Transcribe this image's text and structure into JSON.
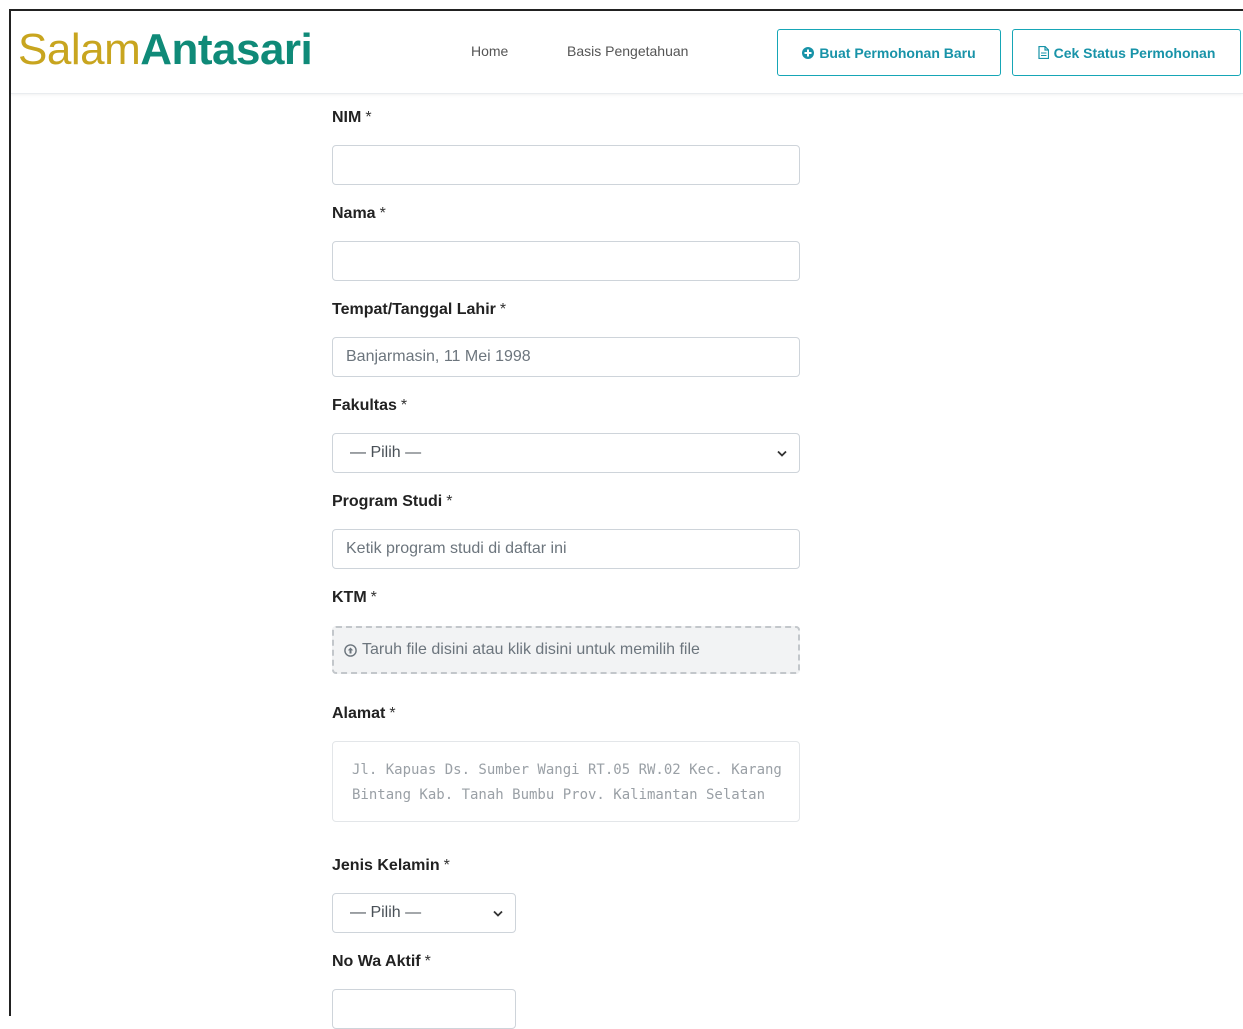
{
  "brand": {
    "part1": "Salam",
    "part2": "Antasari"
  },
  "nav": {
    "home": "Home",
    "knowledge_base": "Basis Pengetahuan",
    "new_request": "Buat Permohonan Baru",
    "check_status": "Cek Status Permohonan"
  },
  "form": {
    "nim": {
      "label": "NIM",
      "required": "*",
      "value": "",
      "placeholder": ""
    },
    "nama": {
      "label": "Nama",
      "required": "*",
      "value": "",
      "placeholder": ""
    },
    "ttl": {
      "label": "Tempat/Tanggal Lahir",
      "required": "*",
      "placeholder": "Banjarmasin, 11 Mei 1998"
    },
    "fakultas": {
      "label": "Fakultas",
      "required": "*",
      "selected": "— Pilih —"
    },
    "prodi": {
      "label": "Program Studi",
      "required": "*",
      "placeholder": "Ketik program studi di daftar ini"
    },
    "ktm": {
      "label": "KTM",
      "required": "*",
      "dropzone_text": "Taruh file disini atau klik disini untuk memilih file"
    },
    "alamat": {
      "label": "Alamat",
      "required": "*",
      "placeholder": "Jl. Kapuas Ds. Sumber Wangi RT.05 RW.02 Kec. Karang Bintang Kab. Tanah Bumbu Prov. Kalimantan Selatan"
    },
    "jenis_kelamin": {
      "label": "Jenis Kelamin",
      "required": "*",
      "selected": "— Pilih —"
    },
    "no_wa": {
      "label": "No Wa Aktif",
      "required": "*",
      "value": ""
    }
  },
  "colors": {
    "brand_gold": "#c8a51f",
    "brand_green": "#0f8a78",
    "button_accent": "#16a6b6"
  }
}
